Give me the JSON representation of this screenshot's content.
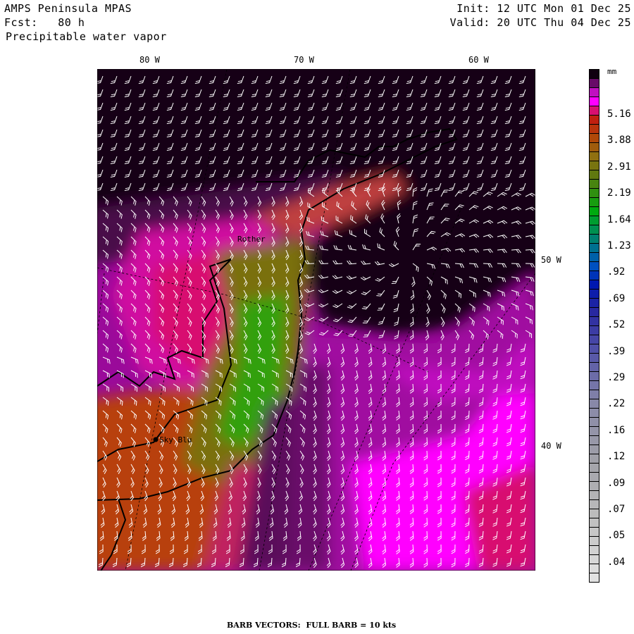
{
  "header": {
    "model": "AMPS Peninsula MPAS",
    "forecast": "Fcst:   80 h",
    "field": "Precipitable water vapor",
    "init": "Init: 12 UTC Mon 01 Dec 25",
    "valid": "Valid: 20 UTC Thu 04 Dec 25"
  },
  "map": {
    "longitude_labels": [
      "80 W",
      "70 W",
      "60 W"
    ],
    "latitude_labels": [
      "50 W",
      "40 W"
    ],
    "places": [
      {
        "name": "Rother"
      },
      {
        "name": "Sky Blu"
      }
    ]
  },
  "colorbar": {
    "unit": "mm",
    "labels": [
      "5.16",
      "3.88",
      "2.91",
      "2.19",
      "1.64",
      "1.23",
      ".92",
      ".69",
      ".52",
      ".39",
      ".29",
      ".22",
      ".16",
      ".12",
      ".09",
      ".07",
      ".05",
      ".04"
    ],
    "color_stops": [
      [
        0,
        "#100010"
      ],
      [
        1,
        "#680a68"
      ],
      [
        2,
        "#c010c0"
      ],
      [
        3,
        "#ff00ff"
      ],
      [
        4,
        "#d81070"
      ],
      [
        5,
        "#c02010"
      ],
      [
        7,
        "#b04808"
      ],
      [
        9,
        "#907010"
      ],
      [
        11,
        "#607810"
      ],
      [
        13,
        "#309010"
      ],
      [
        15,
        "#00aa10"
      ],
      [
        17,
        "#009050"
      ],
      [
        19,
        "#007090"
      ],
      [
        21,
        "#0050c0"
      ],
      [
        23,
        "#0018b0"
      ],
      [
        26,
        "#2828a0"
      ],
      [
        30,
        "#5050a8"
      ],
      [
        36,
        "#8888a8"
      ],
      [
        42,
        "#a0a0a8"
      ],
      [
        48,
        "#bcbcbc"
      ],
      [
        55,
        "#e2e2e2"
      ]
    ],
    "cell_count": 56
  },
  "footer": "BARB VECTORS:  FULL BARB = 10 kts"
}
